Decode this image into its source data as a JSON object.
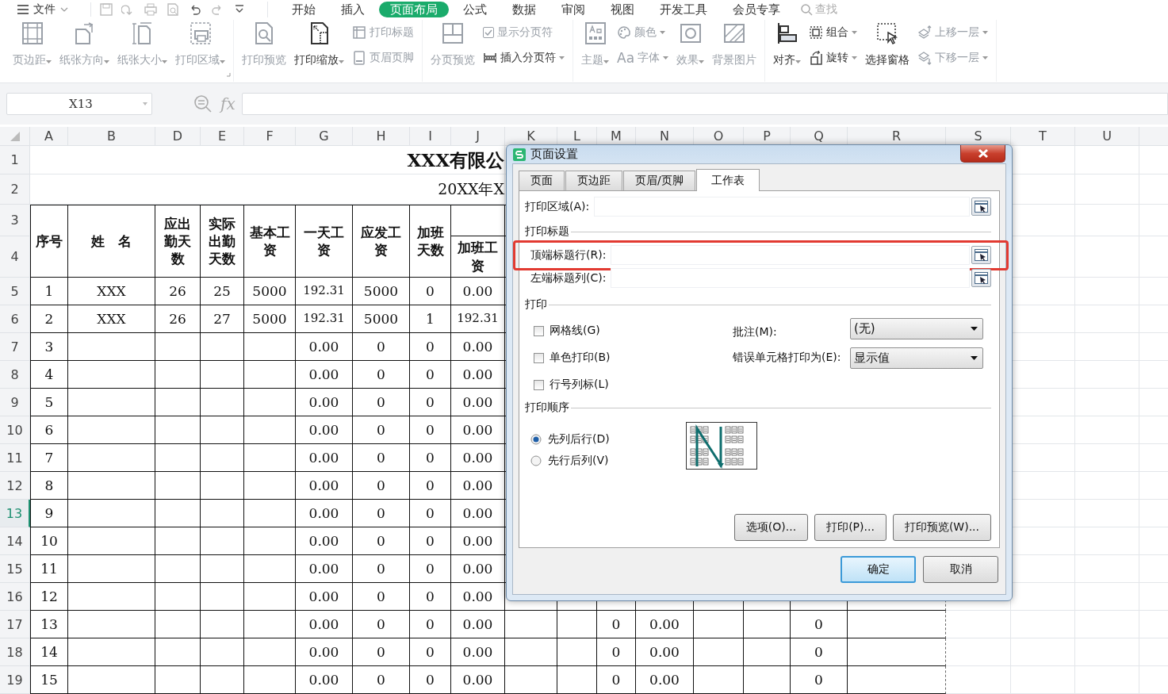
{
  "ribbon": {
    "file_menu": "文件",
    "tabs": [
      {
        "label": "开始",
        "selected": false
      },
      {
        "label": "插入",
        "selected": false
      },
      {
        "label": "页面布局",
        "selected": true
      },
      {
        "label": "公式",
        "selected": false
      },
      {
        "label": "数据",
        "selected": false
      },
      {
        "label": "审阅",
        "selected": false
      },
      {
        "label": "视图",
        "selected": false
      },
      {
        "label": "开发工具",
        "selected": false
      },
      {
        "label": "会员专享",
        "selected": false
      }
    ],
    "search": {
      "placeholder": "查找"
    },
    "groups": [
      {
        "items": [
          {
            "kind": "large",
            "label": "页边距",
            "dropdown": true,
            "disabled": true
          },
          {
            "kind": "large",
            "label": "纸张方向",
            "dropdown": true,
            "disabled": true
          },
          {
            "kind": "large",
            "label": "纸张大小",
            "dropdown": true,
            "disabled": true
          },
          {
            "kind": "large",
            "label": "打印区域",
            "dropdown": true,
            "disabled": true
          }
        ]
      },
      {
        "items": [
          {
            "kind": "large",
            "label": "打印预览",
            "dropdown": false,
            "disabled": true
          },
          {
            "kind": "large",
            "label": "打印缩放",
            "dropdown": true,
            "disabled": false
          },
          {
            "kind": "stack",
            "items": [
              {
                "kind": "small",
                "label": "打印标题",
                "dropdown": false,
                "disabled": true
              },
              {
                "kind": "small",
                "label": "页眉页脚",
                "dropdown": false,
                "disabled": true
              }
            ]
          }
        ]
      },
      {
        "items": [
          {
            "kind": "large",
            "label": "分页预览",
            "dropdown": false,
            "disabled": true
          },
          {
            "kind": "stack",
            "items": [
              {
                "kind": "check",
                "label": "显示分页符",
                "checked": true,
                "disabled": true
              },
              {
                "kind": "small",
                "label": "插入分页符",
                "dropdown": true,
                "disabled": false
              }
            ]
          }
        ]
      },
      {
        "items": [
          {
            "kind": "large",
            "label": "主题",
            "dropdown": true,
            "disabled": true
          },
          {
            "kind": "stack",
            "items": [
              {
                "kind": "small",
                "label": "颜色",
                "dropdown": true,
                "disabled": true
              },
              {
                "kind": "small",
                "label": "字体",
                "icon_text": "Aa",
                "dropdown": true,
                "disabled": true
              }
            ]
          },
          {
            "kind": "large",
            "label": "效果",
            "dropdown": true,
            "disabled": true
          },
          {
            "kind": "large",
            "label": "背景图片",
            "dropdown": false,
            "disabled": true
          }
        ]
      },
      {
        "items": [
          {
            "kind": "large",
            "label": "对齐",
            "dropdown": true,
            "disabled": false
          },
          {
            "kind": "stack",
            "items": [
              {
                "kind": "small",
                "label": "组合",
                "dropdown": true,
                "disabled": false
              },
              {
                "kind": "small",
                "label": "旋转",
                "dropdown": true,
                "disabled": false
              }
            ]
          },
          {
            "kind": "large",
            "label": "选择窗格",
            "dropdown": false,
            "disabled": false
          },
          {
            "kind": "stack",
            "items": [
              {
                "kind": "small",
                "label": "上移一层",
                "dropdown": true,
                "disabled": true
              },
              {
                "kind": "small",
                "label": "下移一层",
                "dropdown": true,
                "disabled": true
              }
            ]
          }
        ]
      }
    ]
  },
  "formula_bar": {
    "cell_name": "X13",
    "fx": "fx"
  },
  "sheet": {
    "columns": [
      "A",
      "B",
      "D",
      "E",
      "F",
      "G",
      "H",
      "I",
      "J",
      "K",
      "L",
      "M",
      "N",
      "O",
      "P",
      "Q",
      "R",
      "S",
      "T",
      "U"
    ],
    "row_labels": [
      {
        "label": "1",
        "selected": false
      },
      {
        "label": "2",
        "selected": false
      },
      {
        "label": "3",
        "selected": false
      },
      {
        "label": "4",
        "selected": false
      },
      {
        "label": "5",
        "selected": false
      },
      {
        "label": "6",
        "selected": false
      },
      {
        "label": "7",
        "selected": false
      },
      {
        "label": "8",
        "selected": false
      },
      {
        "label": "9",
        "selected": false
      },
      {
        "label": "10",
        "selected": false
      },
      {
        "label": "11",
        "selected": false
      },
      {
        "label": "12",
        "selected": false
      },
      {
        "label": "13",
        "selected": true
      },
      {
        "label": "14",
        "selected": false
      },
      {
        "label": "15",
        "selected": false
      },
      {
        "label": "16",
        "selected": false
      },
      {
        "label": "17",
        "selected": false
      },
      {
        "label": "18",
        "selected": false
      },
      {
        "label": "19",
        "selected": false
      }
    ],
    "title": "XXX有限公",
    "subtitle": "20XX年X",
    "header_cells": [
      {
        "text": "序号",
        "kind": "span"
      },
      {
        "text": "姓　名",
        "kind": "span"
      },
      {
        "text": "应出勤天数",
        "kind": "span"
      },
      {
        "text": "实际出勤天数",
        "kind": "span"
      },
      {
        "text": "基本工资",
        "kind": "span"
      },
      {
        "text": "一天工资",
        "kind": "span"
      },
      {
        "text": "应发工资",
        "kind": "span"
      },
      {
        "text": "加班天数",
        "kind": "span"
      },
      {
        "text": "加班工资",
        "kind": "lower"
      }
    ],
    "data_rows": [
      {
        "cells": [
          "1",
          "XXX",
          "26",
          "25",
          "5000",
          "192.31",
          "5000",
          "0",
          "0.00"
        ]
      },
      {
        "cells": [
          "2",
          "XXX",
          "26",
          "27",
          "5000",
          "192.31",
          "5000",
          "1",
          "192.31"
        ]
      },
      {
        "cells": [
          "3",
          null,
          null,
          null,
          null,
          "0.00",
          "0",
          "0",
          "0.00"
        ]
      },
      {
        "cells": [
          "4",
          null,
          null,
          null,
          null,
          "0.00",
          "0",
          "0",
          "0.00"
        ]
      },
      {
        "cells": [
          "5",
          null,
          null,
          null,
          null,
          "0.00",
          "0",
          "0",
          "0.00"
        ]
      },
      {
        "cells": [
          "6",
          null,
          null,
          null,
          null,
          "0.00",
          "0",
          "0",
          "0.00"
        ]
      },
      {
        "cells": [
          "7",
          null,
          null,
          null,
          null,
          "0.00",
          "0",
          "0",
          "0.00"
        ]
      },
      {
        "cells": [
          "8",
          null,
          null,
          null,
          null,
          "0.00",
          "0",
          "0",
          "0.00"
        ]
      },
      {
        "cells": [
          "9",
          null,
          null,
          null,
          null,
          "0.00",
          "0",
          "0",
          "0.00"
        ]
      },
      {
        "cells": [
          "10",
          null,
          null,
          null,
          null,
          "0.00",
          "0",
          "0",
          "0.00"
        ]
      },
      {
        "cells": [
          "11",
          null,
          null,
          null,
          null,
          "0.00",
          "0",
          "0",
          "0.00"
        ]
      },
      {
        "cells": [
          "12",
          null,
          null,
          null,
          null,
          "0.00",
          "0",
          "0",
          "0.00"
        ]
      },
      {
        "cells": [
          "13",
          null,
          null,
          null,
          null,
          "0.00",
          "0",
          "0",
          "0.00",
          null,
          null,
          "0",
          "0.00",
          null,
          null,
          "0"
        ]
      },
      {
        "cells": [
          "14",
          null,
          null,
          null,
          null,
          "0.00",
          "0",
          "0",
          "0.00",
          null,
          null,
          "0",
          "0.00",
          null,
          null,
          "0"
        ]
      },
      {
        "cells": [
          "15",
          null,
          null,
          null,
          null,
          "0.00",
          "0",
          "0",
          "0.00",
          null,
          null,
          "0",
          "0.00",
          null,
          null,
          "0"
        ]
      }
    ]
  },
  "dialog": {
    "title": "页面设置",
    "tabs": [
      {
        "label": "页面",
        "selected": false
      },
      {
        "label": "页边距",
        "selected": false
      },
      {
        "label": "页眉/页脚",
        "selected": false
      },
      {
        "label": "工作表",
        "selected": true
      }
    ],
    "print_area": {
      "label": "打印区域(A):",
      "highlighted": false
    },
    "titles_section": "打印标题",
    "title_fields": [
      {
        "label": "顶端标题行(R):",
        "highlighted": true
      },
      {
        "label": "左端标题列(C):",
        "highlighted": false
      }
    ],
    "print_section": "打印",
    "checkboxes": [
      {
        "label": "网格线(G)",
        "checked": false
      },
      {
        "label": "单色打印(B)",
        "checked": false
      },
      {
        "label": "行号列标(L)",
        "checked": false
      }
    ],
    "selects": [
      {
        "label": "批注(M):",
        "value": "(无)"
      },
      {
        "label": "错误单元格打印为(E):",
        "value": "显示值"
      }
    ],
    "order_section": "打印顺序",
    "order_options": [
      {
        "label": "先列后行(D)",
        "selected": true
      },
      {
        "label": "先行后列(V)",
        "selected": false
      }
    ],
    "action_buttons": [
      "选项(O)...",
      "打印(P)...",
      "打印预览(W)..."
    ],
    "footer_buttons": [
      {
        "label": "确定",
        "default": true
      },
      {
        "label": "取消",
        "default": false
      }
    ]
  }
}
